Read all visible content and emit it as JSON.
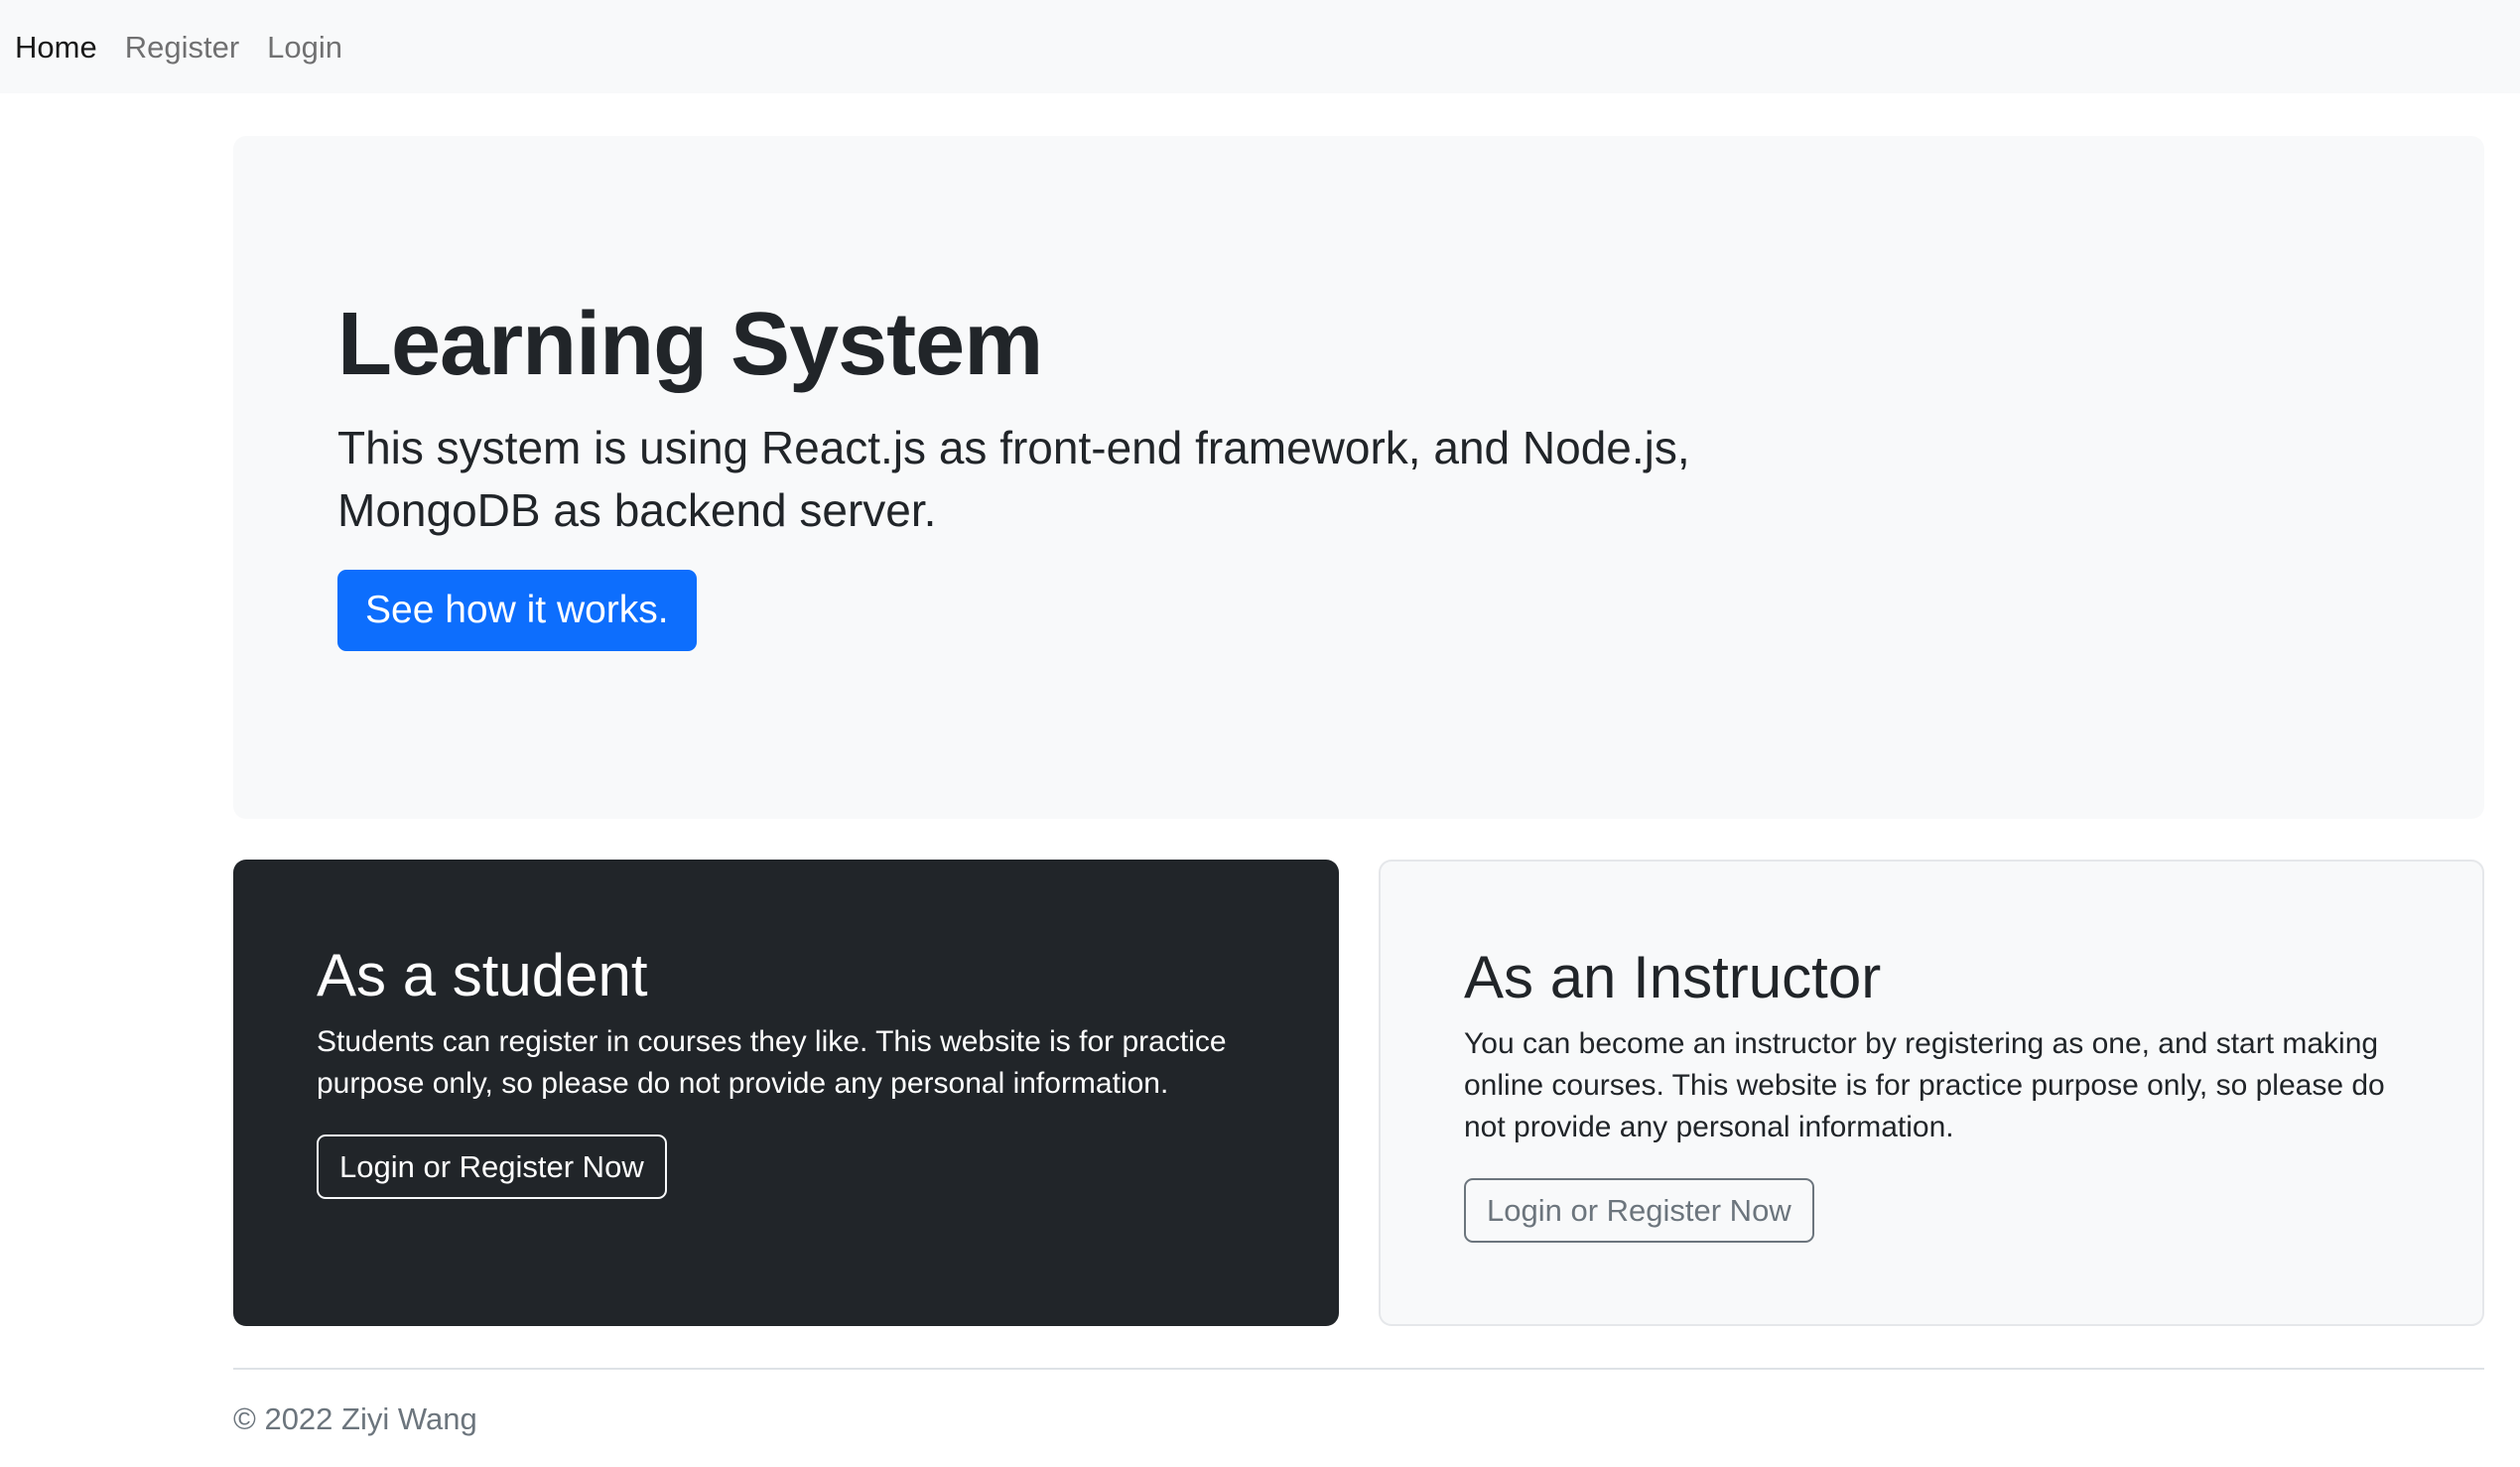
{
  "nav": {
    "items": [
      {
        "label": "Home",
        "active": true
      },
      {
        "label": "Register",
        "active": false
      },
      {
        "label": "Login",
        "active": false
      }
    ]
  },
  "hero": {
    "title": "Learning System",
    "text": "This system is using React.js as front-end framework, and Node.js, MongoDB as backend server.",
    "button_label": "See how it works."
  },
  "cards": {
    "student": {
      "title": "As a student",
      "text": "Students can register in courses they like. This website is for practice purpose only, so please do not provide any personal information.",
      "button_label": "Login or Register Now"
    },
    "instructor": {
      "title": "As an Instructor",
      "text": "You can become an instructor by registering as one, and start making online courses. This website is for practice purpose only, so please do not provide any personal information.",
      "button_label": "Login or Register Now"
    }
  },
  "footer": {
    "text": "© 2022 Ziyi Wang"
  },
  "colors": {
    "primary": "#0d6efd",
    "dark": "#212529",
    "light": "#f8f9fa",
    "secondary": "#6c757d"
  }
}
